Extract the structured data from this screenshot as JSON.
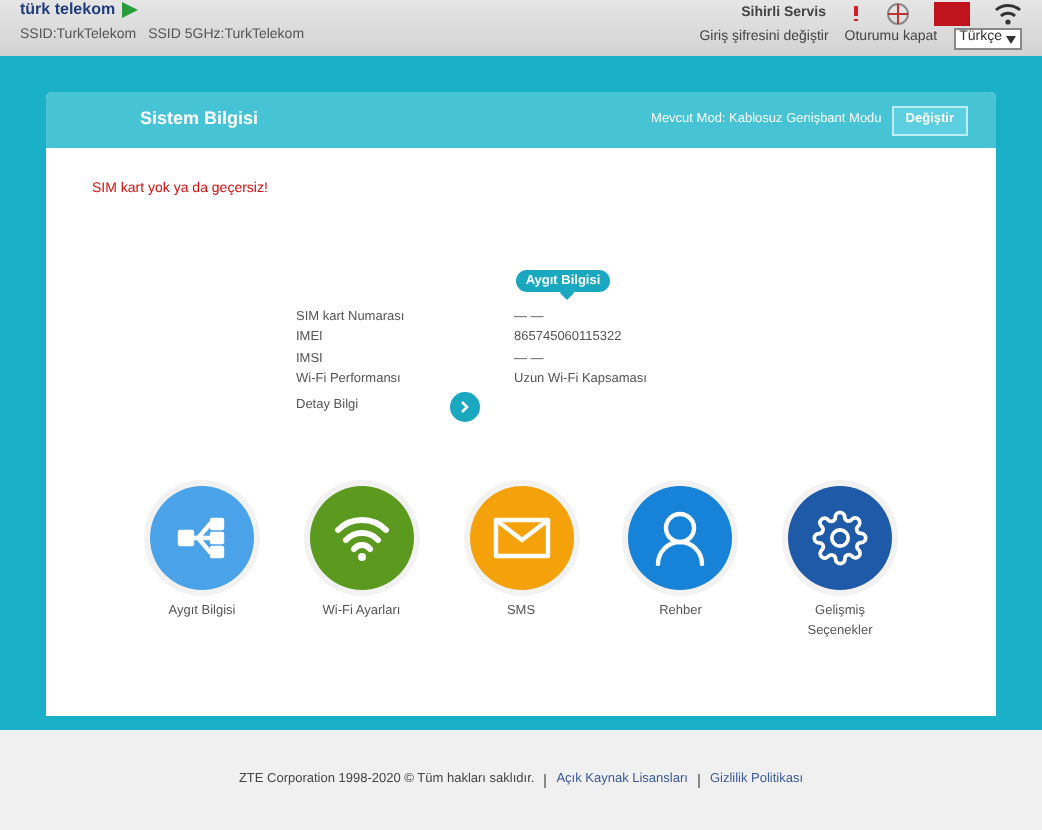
{
  "header": {
    "logo_text": "türk telekom",
    "service": "Sihirli Servis",
    "ssids": [
      "SSID:TurkTelekom",
      "SSID 5GHz:TurkTelekom"
    ],
    "change_password": "Giriş şifresini değiştir",
    "logout": "Oturumu kapat",
    "language": "Türkçe"
  },
  "card": {
    "title": "Sistem Bilgisi",
    "mode_label": "Mevcut Mod: Kablosuz Genişbant Modu",
    "change_button": "Değiştir",
    "alert": "SIM kart yok ya da geçersiz!",
    "tooltip": "Aygıt Bilgisi",
    "rows": [
      {
        "label": "SIM kart Numarası",
        "value": "— —"
      },
      {
        "label": "IMEI",
        "value": "865745060115322"
      },
      {
        "label": "IMSI",
        "value": "— —"
      },
      {
        "label": "Wi-Fi Performansı",
        "value": "Uzun Wi-Fi Kapsaması"
      }
    ],
    "detail": "Detay Bilgi"
  },
  "shortcuts": [
    {
      "kind": "device",
      "label": "Aygıt Bilgisi",
      "color": "#4aa3e8"
    },
    {
      "kind": "wifi",
      "label": "Wi-Fi Ayarları",
      "color": "#5b9a1f"
    },
    {
      "kind": "sms",
      "label": "SMS",
      "color": "#f5a10a"
    },
    {
      "kind": "contacts",
      "label": "Rehber",
      "color": "#1683d8"
    },
    {
      "kind": "settings",
      "label": "Gelişmiş Seçenekler",
      "color": "#1f5aa8"
    }
  ],
  "footer": {
    "copyright": "ZTE Corporation 1998-2020 © Tüm hakları saklıdır.",
    "links": [
      "Açık Kaynak Lisansları",
      "Gizlilik Politikası"
    ]
  }
}
